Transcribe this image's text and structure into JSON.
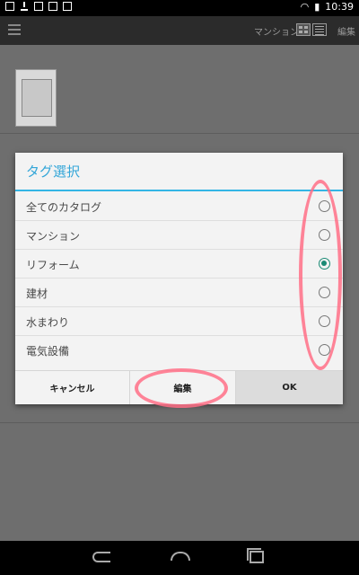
{
  "status_bar": {
    "time": "10:39"
  },
  "app_bar": {
    "current_tag": "マンション",
    "edit_label": "編集"
  },
  "dialog": {
    "title": "タグ選択",
    "options": [
      {
        "label": "全てのカタログ",
        "checked": false
      },
      {
        "label": "マンション",
        "checked": false
      },
      {
        "label": "リフォーム",
        "checked": true
      },
      {
        "label": "建材",
        "checked": false
      },
      {
        "label": "水まわり",
        "checked": false
      },
      {
        "label": "電気設備",
        "checked": false
      }
    ],
    "buttons": {
      "cancel": "キャンセル",
      "edit": "編集",
      "ok": "OK"
    }
  },
  "colors": {
    "accent": "#33b5e5",
    "radio_checked": "#1a8a74",
    "highlight": "#ff6f86"
  }
}
